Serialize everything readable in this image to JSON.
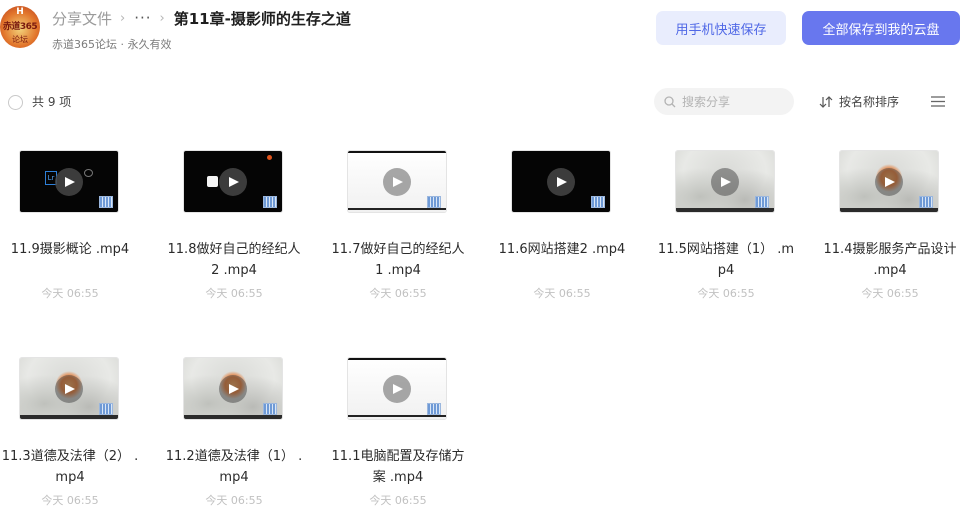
{
  "header": {
    "avatar": {
      "top": "H",
      "main": "赤道365",
      "bottom": "论坛"
    },
    "breadcrumb": {
      "root": "分享文件",
      "more": "···",
      "current": "第11章-摄影师的生存之道"
    },
    "subline": "赤道365论坛 · 永久有效",
    "phone_save_label": "用手机快速保存",
    "save_all_label": "全部保存到我的云盘"
  },
  "toolbar": {
    "count_label": "共 9 项",
    "search_placeholder": "搜索分享",
    "sort_label": "按名称排序"
  },
  "files": [
    {
      "name": "11.9摄影概论 .mp4",
      "time": "今天 06:55",
      "thumb": "dark-lr"
    },
    {
      "name": "11.8做好自己的经纪人2 .mp4",
      "time": "今天 06:55",
      "thumb": "dark-apple"
    },
    {
      "name": "11.7做好自己的经纪人1 .mp4",
      "time": "今天 06:55",
      "thumb": "light"
    },
    {
      "name": "11.6网站搭建2 .mp4",
      "time": "今天 06:55",
      "thumb": "dark"
    },
    {
      "name": "11.5网站搭建（1） .mp4",
      "time": "今天 06:55",
      "thumb": "cloud"
    },
    {
      "name": "11.4摄影服务产品设计 .mp4",
      "time": "今天 06:55",
      "thumb": "cloud-sun"
    },
    {
      "name": "11.3道德及法律（2） .mp4",
      "time": "今天 06:55",
      "thumb": "cloud-sun"
    },
    {
      "name": "11.2道德及法律（1） .mp4",
      "time": "今天 06:55",
      "thumb": "cloud-sun"
    },
    {
      "name": "11.1电脑配置及存储方案 .mp4",
      "time": "今天 06:55",
      "thumb": "light"
    }
  ]
}
